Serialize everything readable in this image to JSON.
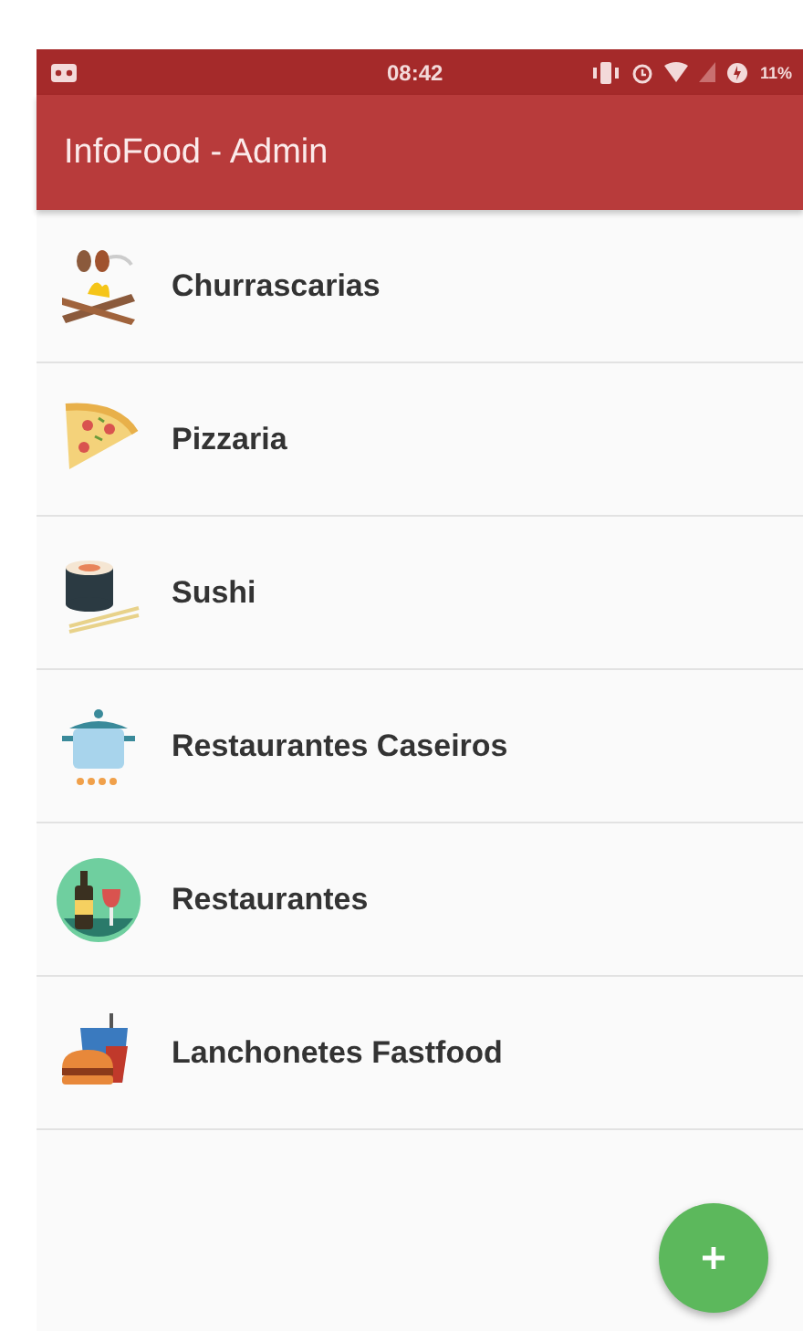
{
  "status_bar": {
    "time": "08:42",
    "battery": "11%"
  },
  "app_bar": {
    "title": "InfoFood - Admin"
  },
  "categories": [
    {
      "label": "Churrascarias",
      "kind": "grill"
    },
    {
      "label": "Pizzaria",
      "kind": "pizza"
    },
    {
      "label": "Sushi",
      "kind": "sushi"
    },
    {
      "label": "Restaurantes Caseiros",
      "kind": "pot"
    },
    {
      "label": "Restaurantes",
      "kind": "wine"
    },
    {
      "label": "Lanchonetes Fastfood",
      "kind": "fastfood"
    }
  ],
  "fab": {
    "kind": "add"
  }
}
